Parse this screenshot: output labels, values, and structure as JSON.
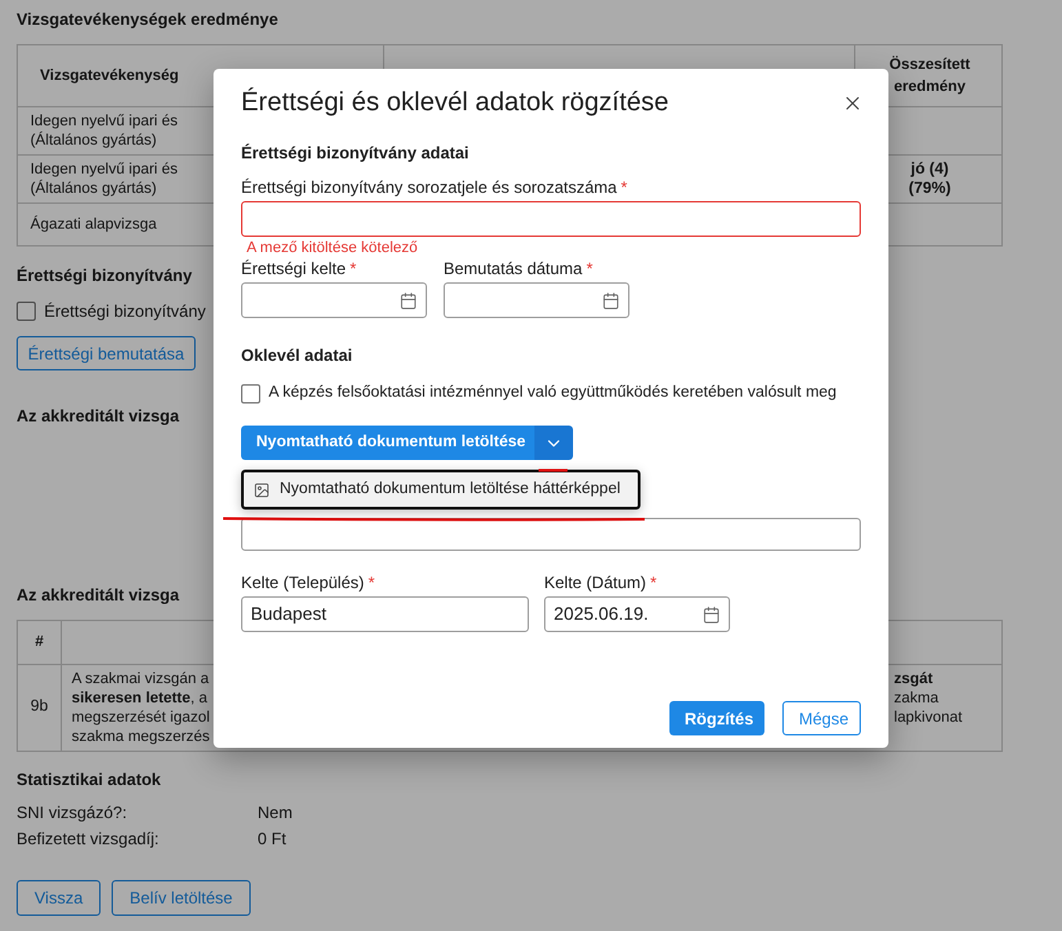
{
  "background": {
    "results": {
      "title": "Vizsgatevékenységek eredménye",
      "columns": [
        {
          "label": "Vizsgatevékenység"
        },
        {
          "label": "Összesített eredmény"
        }
      ],
      "rows": [
        {
          "activity": [
            "Idegen nyelvű ipari és",
            "(Általános gyártás)"
          ]
        },
        {
          "activity": [
            "Idegen nyelvű ipari és",
            "(Általános gyártás)"
          ],
          "total": [
            "jó (4)",
            "(79%)"
          ]
        },
        {
          "activity": [
            "Ágazati alapvizsga"
          ]
        }
      ]
    },
    "certificate": {
      "title": "Érettségi bizonyítvány",
      "checkbox": {
        "label": "Érettségi bizonyítvány",
        "checked": false
      },
      "button": "Érettségi bemutatása"
    },
    "center_sections": [
      {
        "title": "Az akkreditált vizsga"
      },
      {
        "title": "Az akkreditált vizsga"
      }
    ],
    "clause_table": {
      "columns": [
        {
          "label": "#"
        }
      ],
      "rows": [
        {
          "number": "9b",
          "left_lines": [
            "A szakmai vizsgán a",
            "**sikeresen letette**, a",
            "megszerzését igazol",
            "szakma megszerzés"
          ],
          "right_lines": [
            "**zsgát**",
            "zakma",
            "lapkivonat"
          ]
        }
      ]
    },
    "statistics": {
      "title": "Statisztikai adatok",
      "items": [
        {
          "label": "SNI vizsgázó?:",
          "value": "Nem"
        },
        {
          "label": "Befizetett vizsgadíj:",
          "value": "0 Ft"
        }
      ]
    },
    "buttons": [
      "Vissza",
      "Belív letöltése"
    ]
  },
  "dialog": {
    "title": "Érettségi és oklevél adatok rögzítése",
    "certificate_section": {
      "title": "Érettségi bizonyítvány adatai",
      "serial_field": {
        "label": "Érettségi bizonyítvány sorozatjele és sorozatszáma",
        "required_mark": "*",
        "invalid": true,
        "error": "A mező kitöltése kötelező"
      },
      "date_fields": [
        {
          "label": "Érettségi kelte",
          "required_mark": "*",
          "kind": "date"
        },
        {
          "label": "Bemutatás dátuma",
          "required_mark": "*",
          "kind": "date"
        }
      ]
    },
    "diploma_section": {
      "title": "Oklevél adatai",
      "checkbox": {
        "label": "A képzés felsőoktatási intézménnyel való együttműködés keretében valósult meg",
        "checked": false
      },
      "split_button": {
        "label": "Nyomtatható dokumentum letöltése",
        "menu_open": true,
        "menu": [
          {
            "label": "Nyomtatható dokumentum letöltése háttérképpel",
            "focused": true
          }
        ]
      },
      "place_fields": [
        {
          "label": "Kelte (Település)",
          "required_mark": "*",
          "kind": "text",
          "value": "Budapest"
        },
        {
          "label": "Kelte (Dátum)",
          "required_mark": "*",
          "kind": "date",
          "value": "2025.06.19."
        }
      ]
    },
    "actions": [
      {
        "label": "Rögzítés",
        "kind": "primary"
      },
      {
        "label": "Mégse",
        "kind": "secondary"
      }
    ]
  }
}
